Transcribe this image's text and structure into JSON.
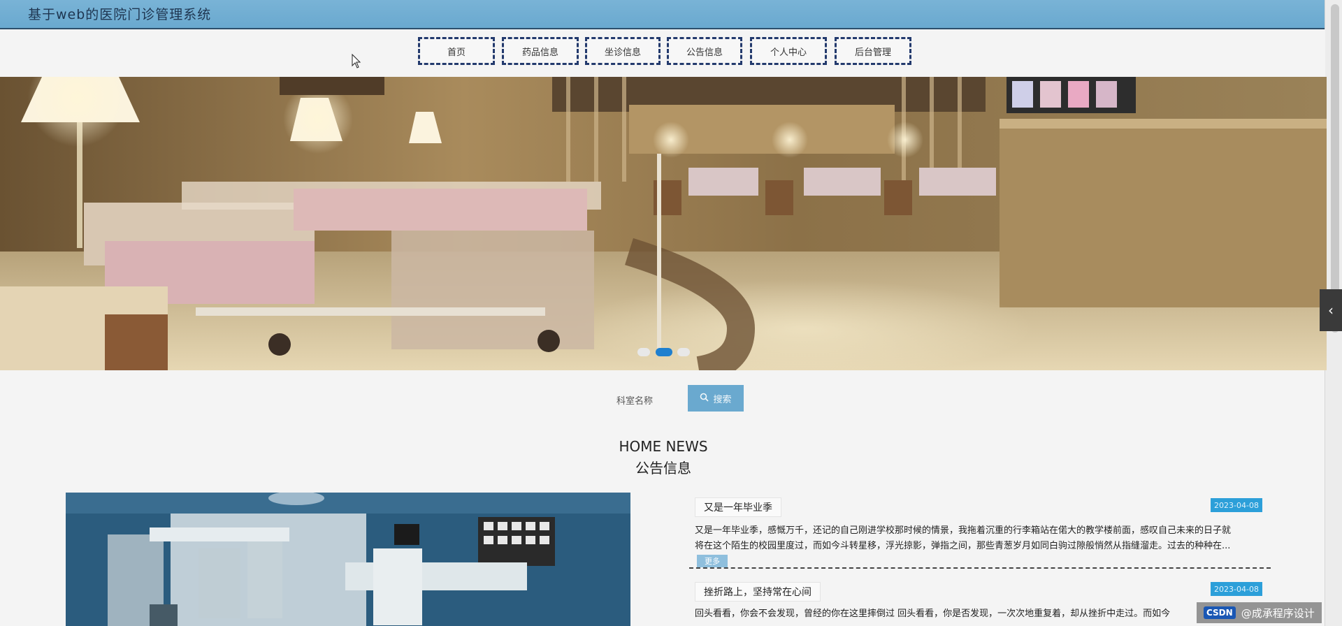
{
  "header": {
    "title": "基于web的医院门诊管理系统"
  },
  "nav": {
    "items": [
      "首页",
      "药品信息",
      "坐诊信息",
      "公告信息",
      "个人中心",
      "后台管理"
    ]
  },
  "banner": {
    "slides": 3,
    "active_slide": 2
  },
  "search": {
    "label": "科室名称",
    "button": "搜索",
    "icon": "search-icon"
  },
  "section": {
    "title_en": "HOME NEWS",
    "title_cn": "公告信息"
  },
  "news": [
    {
      "title": "又是一年毕业季",
      "date": "2023-04-08",
      "text1": "又是一年毕业季，感慨万千，还记的自己刚进学校那时候的情景，我拖着沉重的行李箱站在偌大的教学楼前面，感叹自己未来的日子就",
      "text2": "将在这个陌生的校园里度过，而如今斗转星移，浮光掠影，弹指之间，那些青葱岁月如同白驹过隙般悄然从指缝溜走。过去的种种在...",
      "more": "更多"
    },
    {
      "title": "挫折路上，坚持常在心间",
      "date": "2023-04-08",
      "text1": "回头看看，你会不会发现，曾经的你在这里摔倒过 回头看看，你是否发现，一次次地重复着，却从挫折中走过。而如今",
      "text2": "",
      "more": ""
    }
  ],
  "watermark": {
    "brand": "CSDN",
    "text": "@成承程序设计"
  },
  "side_toggle": {
    "icon": "chevron-left-icon"
  },
  "colors": {
    "header_bg": "#6aa9cf",
    "nav_border": "#233a6d",
    "date_badge": "#2c9fd9",
    "active_dot": "#1e7fcf"
  }
}
